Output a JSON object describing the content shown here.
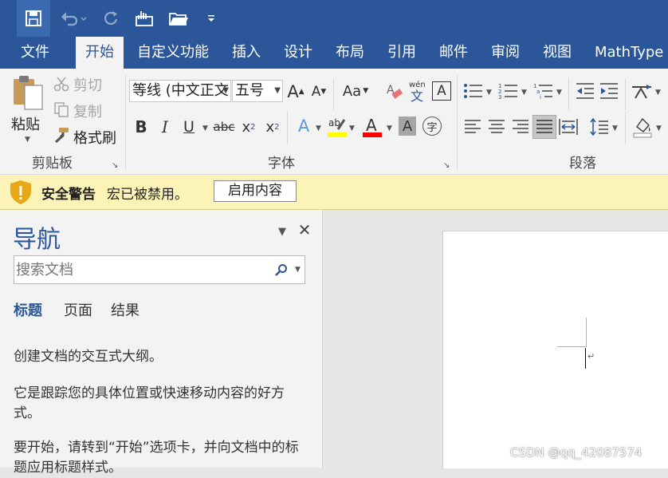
{
  "quick_access": {
    "items": [
      "save-icon",
      "undo-icon",
      "redo-icon",
      "touch-mode-icon",
      "open-folder-icon",
      "customize-icon"
    ]
  },
  "tabs": [
    {
      "label": "文件",
      "active": false
    },
    {
      "label": "开始",
      "active": true
    },
    {
      "label": "自定义功能",
      "active": false
    },
    {
      "label": "插入",
      "active": false
    },
    {
      "label": "设计",
      "active": false
    },
    {
      "label": "布局",
      "active": false
    },
    {
      "label": "引用",
      "active": false
    },
    {
      "label": "邮件",
      "active": false
    },
    {
      "label": "审阅",
      "active": false
    },
    {
      "label": "视图",
      "active": false
    },
    {
      "label": "MathType",
      "active": false
    }
  ],
  "clipboard": {
    "paste": "粘贴",
    "cut": "剪切",
    "copy": "复制",
    "format_painter": "格式刷",
    "group_label": "剪贴板"
  },
  "font": {
    "font_name": "等线 (中文正文",
    "font_size": "五号",
    "change_case": "Aa",
    "group_label": "字体"
  },
  "paragraph": {
    "group_label": "段落"
  },
  "security": {
    "title": "安全警告",
    "message": "宏已被禁用。",
    "button": "启用内容"
  },
  "nav": {
    "title": "导航",
    "search_placeholder": "搜索文档",
    "tabs": [
      "标题",
      "页面",
      "结果"
    ],
    "text1": "创建文档的交互式大纲。",
    "text2": "它是跟踪您的具体位置或快速移动内容的好方式。",
    "text3": "要开始，请转到“开始”选项卡，并向文档中的标题应用标题样式。"
  },
  "watermark": "CSDN @qq_42087574",
  "colors": {
    "brand": "#2b579a",
    "highlight": "#ffff00",
    "font_color": "#ff0000",
    "warning_bg": "#fcf3b6"
  }
}
